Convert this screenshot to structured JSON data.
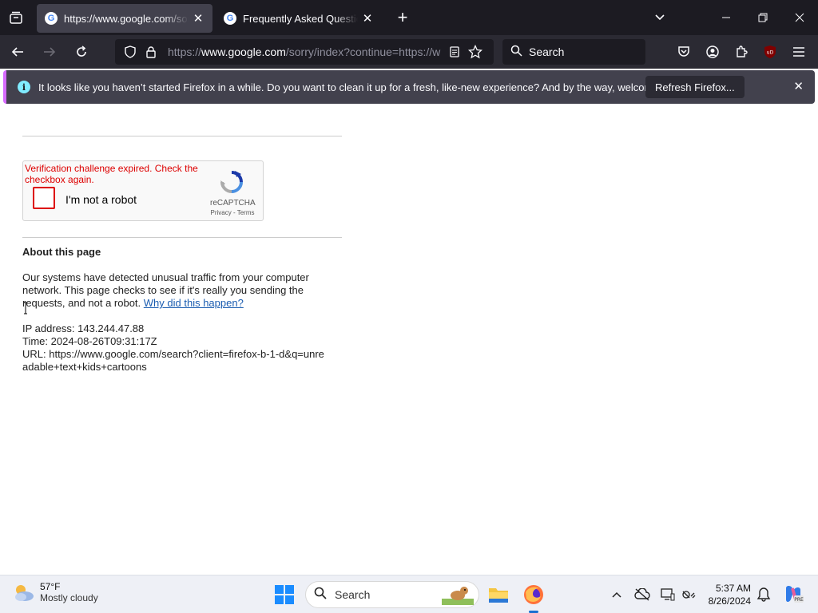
{
  "browser": {
    "tabs": [
      {
        "title": "https://www.google.com/sorry/index?continue=https",
        "active": true
      },
      {
        "title": "Frequently Asked Questions | reCAPTCHA",
        "active": false
      }
    ],
    "url": {
      "prefix": "https://",
      "host": "www.google.com",
      "rest": "/sorry/index?continue=https://w"
    },
    "search_placeholder": "Search",
    "notification": {
      "message": "It looks like you haven’t started Firefox in a while. Do you want to clean it up for a fresh, like-new experience? And by the way, welcome back!",
      "refresh_label": "Refresh Firefox..."
    }
  },
  "page": {
    "captcha": {
      "error": "Verification challenge expired. Check the checkbox again.",
      "checkbox_label": "I'm not a robot",
      "brand": "reCAPTCHA",
      "links": "Privacy - Terms"
    },
    "about_title": "About this page",
    "paragraph": "Our systems have detected unusual traffic from your computer network. This page checks to see if it's really you sending the requests, and not a robot.",
    "why_link": "Why did this happen?",
    "ip_line": "IP address: 143.244.47.88",
    "time_line": "Time: 2024-08-26T09:31:17Z",
    "url_line": "URL: https://www.google.com/search?client=firefox-b-1-d&q=unreadable+text+kids+cartoons"
  },
  "taskbar": {
    "weather_temp": "57°F",
    "weather_desc": "Mostly cloudy",
    "search_label": "Search",
    "time": "5:37 AM",
    "date": "8/26/2024"
  },
  "colors": {
    "chrome_dark": "#1c1b22",
    "toolbar": "#2b2a33",
    "error_red": "#dd0000",
    "link_blue": "#1a5cb0"
  },
  "icons": [
    "tab-list-icon",
    "google-favicon",
    "close-icon",
    "plus-icon",
    "chevron-down-icon",
    "minimize-icon",
    "restore-icon",
    "back-arrow-icon",
    "forward-arrow-icon",
    "reload-icon",
    "shield-icon",
    "lock-icon",
    "reader-view-icon",
    "bookmark-star-icon",
    "search-icon",
    "pocket-icon",
    "account-icon",
    "extensions-icon",
    "ublock-icon",
    "hamburger-menu-icon",
    "info-icon",
    "recaptcha-logo-icon",
    "weather-icon",
    "windows-start-icon",
    "file-explorer-icon",
    "firefox-icon",
    "chevron-up-icon",
    "cloud-offline-icon",
    "display-icon",
    "network-icon",
    "bell-icon",
    "copilot-icon"
  ]
}
